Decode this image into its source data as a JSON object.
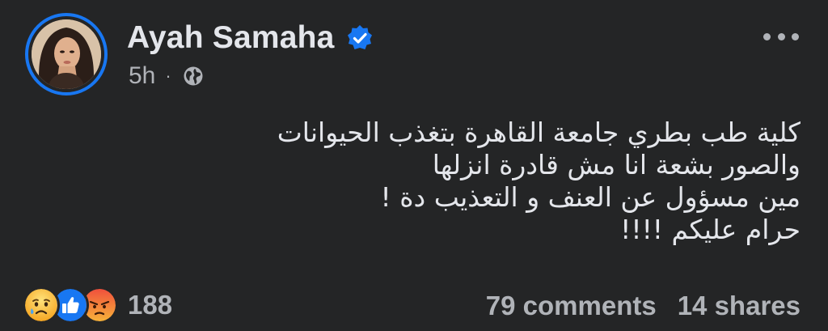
{
  "post": {
    "author_name": "Ayah Samaha",
    "verified": true,
    "time": "5h",
    "separator": "·",
    "audience_icon": "globe-icon",
    "more_icon": "more-options-icon",
    "text_lines": [
      "كلية طب بطري جامعة القاهرة بتغذب الحيوانات",
      "والصور بشعة انا مش قادرة انزلها",
      "مين مسؤول عن العنف و التعذيب دة !",
      "حرام عليكم !!!!"
    ],
    "reactions": {
      "icons": [
        "sad-reaction-icon",
        "like-reaction-icon",
        "angry-reaction-icon"
      ],
      "count": "188"
    },
    "comments": "79 comments",
    "shares": "14 shares"
  },
  "colors": {
    "background": "#242526",
    "primary_text": "#e4e6eb",
    "secondary_text": "#b0b3b8",
    "accent_blue": "#1877f2"
  }
}
